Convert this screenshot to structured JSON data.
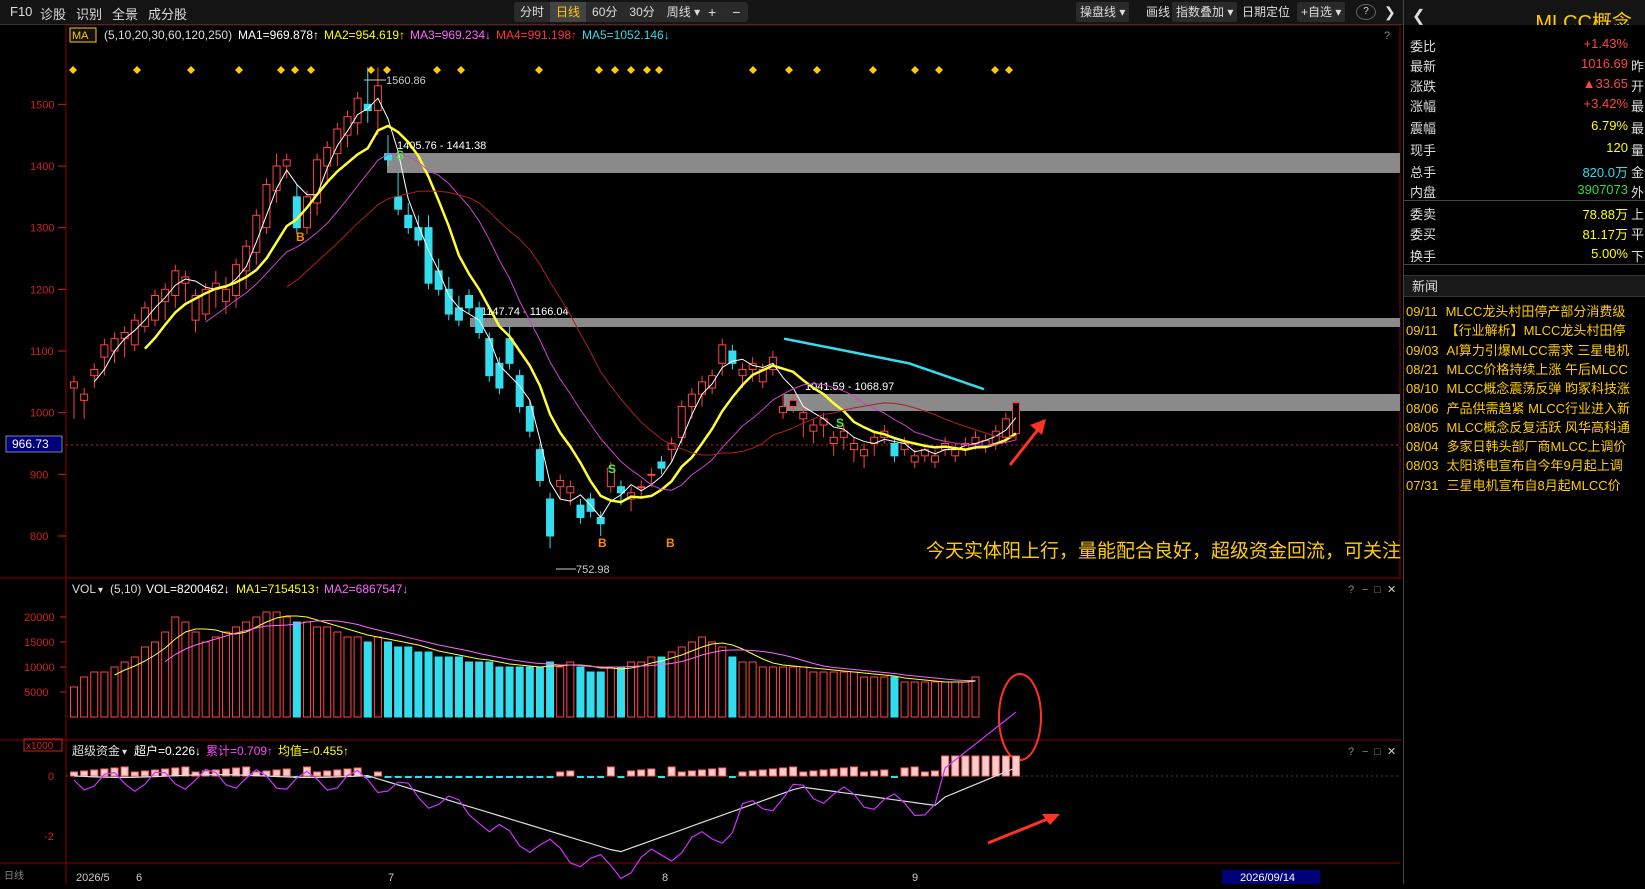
{
  "toolbar": {
    "left_items": [
      "F10",
      "诊股",
      "识别",
      "全景",
      "成分股"
    ],
    "period_tabs": [
      "分时",
      "日线",
      "60分",
      "30分",
      "周线"
    ],
    "active_tab": "日线",
    "zoom_in": "+",
    "zoom_out": "−",
    "right_items": [
      "操盘线",
      "画线",
      "指数叠加",
      "日期定位",
      "自选"
    ],
    "help": "?"
  },
  "ma_legend": {
    "selector": "MA",
    "params": "(5,10,20,30,60,120,250)",
    "items": [
      {
        "text": "MA1=969.878↑",
        "color": "#ffffff"
      },
      {
        "text": "MA2=954.619↑",
        "color": "#ffff00"
      },
      {
        "text": "MA3=969.234↓",
        "color": "#ff66ff"
      },
      {
        "text": "MA4=991.198↑",
        "color": "#ff3333"
      },
      {
        "text": "MA5=1052.146↓",
        "color": "#33ddee"
      }
    ]
  },
  "price_axis": {
    "ticks": [
      "1500",
      "1400",
      "1300",
      "1200",
      "1100",
      "1000",
      "900",
      "800"
    ],
    "current": "966.73"
  },
  "annotations": {
    "high": "1560.86",
    "low": "752.98",
    "zone1": "1405.76 - 1441.38",
    "zone2": "1147.74 - 1166.04",
    "zone3": "1041.59 - 1068.97",
    "comment": "今天实体阳上行，量能配合良好，超级资金回流，可关注",
    "signal_b": "B",
    "signal_s": "S"
  },
  "volume_panel": {
    "title": "VOL",
    "params": "(5,10)",
    "vol": "VOL=8200462↓",
    "ma1": "MA1=7154513↑",
    "ma2": "MA2=6867547↓",
    "ticks": [
      "20000",
      "15000",
      "10000",
      "5000"
    ],
    "unit": "x1000"
  },
  "flow_panel": {
    "title": "超级资金",
    "chaohu": "超户=0.226↓",
    "leiji": "累计=0.709↑",
    "junzhi": "均值=-0.455↑",
    "ticks": [
      "0",
      "-2"
    ]
  },
  "date_axis": {
    "labels": [
      "2026/5",
      "6",
      "7",
      "8",
      "9"
    ],
    "cursor_date": "2026/09/14"
  },
  "sidebar": {
    "stock_name": "MLCC概念",
    "quotes": [
      {
        "label": "委比",
        "value": "+1.43%",
        "extra": "",
        "color": "#ff4444"
      },
      {
        "label": "最新",
        "value": "1016.69",
        "extra": "昨",
        "color": "#ff4444"
      },
      {
        "label": "涨跌",
        "value": "▲33.65",
        "extra": "开",
        "color": "#ff4444"
      },
      {
        "label": "涨幅",
        "value": "+3.42%",
        "extra": "最",
        "color": "#ff4444"
      },
      {
        "label": "震幅",
        "value": "6.79%",
        "extra": "最",
        "color": "#ffff00"
      },
      {
        "label": "现手",
        "value": "120",
        "extra": "量",
        "color": "#ffff00"
      },
      {
        "label": "总手",
        "value": "820.0万",
        "extra": "金",
        "color": "#33ddee"
      },
      {
        "label": "内盘",
        "value": "3907073",
        "extra": "外",
        "color": "#33dd33"
      },
      {
        "label": "委卖",
        "value": "78.88万",
        "extra": "上",
        "color": "#ffff00"
      },
      {
        "label": "委买",
        "value": "81.17万",
        "extra": "平",
        "color": "#ffff00"
      },
      {
        "label": "换手",
        "value": "5.00%",
        "extra": "下",
        "color": "#ffff00"
      }
    ],
    "news_title": "新闻",
    "news": [
      {
        "date": "09/11",
        "title": "MLCC龙头村田停产部分消费级"
      },
      {
        "date": "09/11",
        "title": "【行业解析】MLCC龙头村田停"
      },
      {
        "date": "09/03",
        "title": "AI算力引爆MLCC需求 三星电机"
      },
      {
        "date": "08/21",
        "title": "MLCC价格持续上涨 午后MLCC"
      },
      {
        "date": "08/10",
        "title": "MLCC概念震荡反弹 昀冢科技涨"
      },
      {
        "date": "08/06",
        "title": "产品供需趋紧 MLCC行业进入新"
      },
      {
        "date": "08/05",
        "title": "MLCC概念反复活跃 风华高科通"
      },
      {
        "date": "08/04",
        "title": "多家日韩头部厂商MLCC上调价"
      },
      {
        "date": "08/03",
        "title": "太阳诱电宣布自今年9月起上调"
      },
      {
        "date": "07/31",
        "title": "三星电机宣布自8月起MLCC价"
      }
    ]
  },
  "chart_data": {
    "type": "candlestick",
    "price_range": [
      740,
      1580
    ],
    "candles": [
      [
        1040,
        1060,
        990,
        1050
      ],
      [
        1020,
        1040,
        990,
        1030
      ],
      [
        1060,
        1080,
        1040,
        1070
      ],
      [
        1090,
        1120,
        1060,
        1110
      ],
      [
        1100,
        1130,
        1080,
        1120
      ],
      [
        1120,
        1140,
        1090,
        1130
      ],
      [
        1110,
        1160,
        1100,
        1150
      ],
      [
        1140,
        1180,
        1130,
        1170
      ],
      [
        1150,
        1200,
        1140,
        1190
      ],
      [
        1180,
        1210,
        1150,
        1200
      ],
      [
        1190,
        1240,
        1170,
        1230
      ],
      [
        1210,
        1230,
        1180,
        1220
      ],
      [
        1150,
        1200,
        1130,
        1190
      ],
      [
        1160,
        1210,
        1150,
        1200
      ],
      [
        1200,
        1230,
        1170,
        1210
      ],
      [
        1180,
        1220,
        1160,
        1200
      ],
      [
        1190,
        1250,
        1170,
        1240
      ],
      [
        1230,
        1280,
        1200,
        1270
      ],
      [
        1260,
        1330,
        1240,
        1320
      ],
      [
        1300,
        1380,
        1290,
        1370
      ],
      [
        1360,
        1420,
        1340,
        1400
      ],
      [
        1400,
        1420,
        1380,
        1410
      ],
      [
        1350,
        1370,
        1290,
        1300
      ],
      [
        1300,
        1360,
        1290,
        1350
      ],
      [
        1340,
        1420,
        1320,
        1410
      ],
      [
        1400,
        1440,
        1370,
        1430
      ],
      [
        1420,
        1470,
        1400,
        1460
      ],
      [
        1450,
        1490,
        1430,
        1480
      ],
      [
        1470,
        1520,
        1450,
        1510
      ],
      [
        1500,
        1560,
        1470,
        1490
      ],
      [
        1490,
        1560,
        1450,
        1530
      ],
      [
        1420,
        1450,
        1400,
        1410
      ],
      [
        1350,
        1390,
        1320,
        1330
      ],
      [
        1320,
        1340,
        1290,
        1300
      ],
      [
        1300,
        1320,
        1270,
        1280
      ],
      [
        1300,
        1320,
        1200,
        1210
      ],
      [
        1230,
        1250,
        1190,
        1200
      ],
      [
        1200,
        1220,
        1150,
        1160
      ],
      [
        1170,
        1190,
        1140,
        1150
      ],
      [
        1190,
        1200,
        1160,
        1170
      ],
      [
        1170,
        1180,
        1120,
        1130
      ],
      [
        1120,
        1130,
        1050,
        1060
      ],
      [
        1080,
        1090,
        1030,
        1040
      ],
      [
        1120,
        1140,
        1070,
        1080
      ],
      [
        1060,
        1070,
        1000,
        1010
      ],
      [
        1010,
        1020,
        960,
        970
      ],
      [
        940,
        950,
        880,
        890
      ],
      [
        860,
        870,
        780,
        800
      ],
      [
        880,
        900,
        860,
        890
      ],
      [
        870,
        890,
        850,
        880
      ],
      [
        850,
        860,
        820,
        830
      ],
      [
        860,
        870,
        830,
        840
      ],
      [
        830,
        840,
        800,
        820
      ],
      [
        880,
        920,
        870,
        910
      ],
      [
        880,
        890,
        850,
        870
      ],
      [
        860,
        880,
        840,
        870
      ],
      [
        880,
        890,
        860,
        880
      ],
      [
        900,
        910,
        880,
        900
      ],
      [
        920,
        930,
        900,
        910
      ],
      [
        940,
        960,
        920,
        950
      ],
      [
        960,
        1020,
        950,
        1010
      ],
      [
        1010,
        1040,
        990,
        1030
      ],
      [
        1030,
        1060,
        1010,
        1050
      ],
      [
        1040,
        1070,
        1030,
        1060
      ],
      [
        1080,
        1120,
        1060,
        1110
      ],
      [
        1100,
        1110,
        1070,
        1080
      ],
      [
        1060,
        1080,
        1040,
        1070
      ],
      [
        1070,
        1090,
        1050,
        1080
      ],
      [
        1050,
        1080,
        1040,
        1070
      ],
      [
        1070,
        1100,
        1060,
        1090
      ],
      [
        1000,
        1030,
        990,
        1010
      ],
      [
        1010,
        1030,
        1000,
        1020
      ],
      [
        990,
        1010,
        960,
        1000
      ],
      [
        970,
        990,
        950,
        980
      ],
      [
        980,
        1000,
        960,
        990
      ],
      [
        950,
        970,
        930,
        960
      ],
      [
        960,
        980,
        940,
        970
      ],
      [
        940,
        960,
        920,
        950
      ],
      [
        930,
        950,
        910,
        940
      ],
      [
        950,
        970,
        930,
        960
      ],
      [
        960,
        980,
        950,
        970
      ],
      [
        950,
        960,
        920,
        930
      ],
      [
        940,
        960,
        930,
        950
      ],
      [
        920,
        940,
        910,
        930
      ],
      [
        930,
        950,
        920,
        940
      ],
      [
        920,
        940,
        910,
        930
      ],
      [
        940,
        960,
        930,
        950
      ],
      [
        930,
        950,
        920,
        940
      ],
      [
        940,
        960,
        930,
        950
      ],
      [
        950,
        970,
        940,
        960
      ],
      [
        945,
        965,
        935,
        955
      ],
      [
        950,
        980,
        940,
        970
      ],
      [
        960,
        1000,
        950,
        990
      ],
      [
        966,
        1020,
        955,
        1016
      ]
    ],
    "volumes": [
      6,
      8,
      9,
      9,
      10,
      11,
      12,
      14,
      15,
      17,
      20,
      19,
      17,
      15,
      16,
      17,
      18,
      19,
      20,
      21,
      21,
      20,
      19,
      19,
      18,
      18,
      17,
      16,
      16,
      15,
      16,
      15,
      14,
      14,
      13,
      13,
      12,
      12,
      12,
      11,
      11,
      11,
      10,
      10,
      10,
      10,
      10,
      11,
      10,
      11,
      10,
      9,
      9,
      10,
      10,
      11,
      11,
      12,
      12,
      13,
      14,
      15,
      16,
      15,
      14,
      12,
      11,
      11,
      10,
      10,
      10,
      10,
      10,
      9,
      9,
      9,
      9,
      9,
      8,
      8,
      8,
      8,
      7,
      7,
      7,
      7,
      7,
      7,
      7,
      8
    ]
  }
}
